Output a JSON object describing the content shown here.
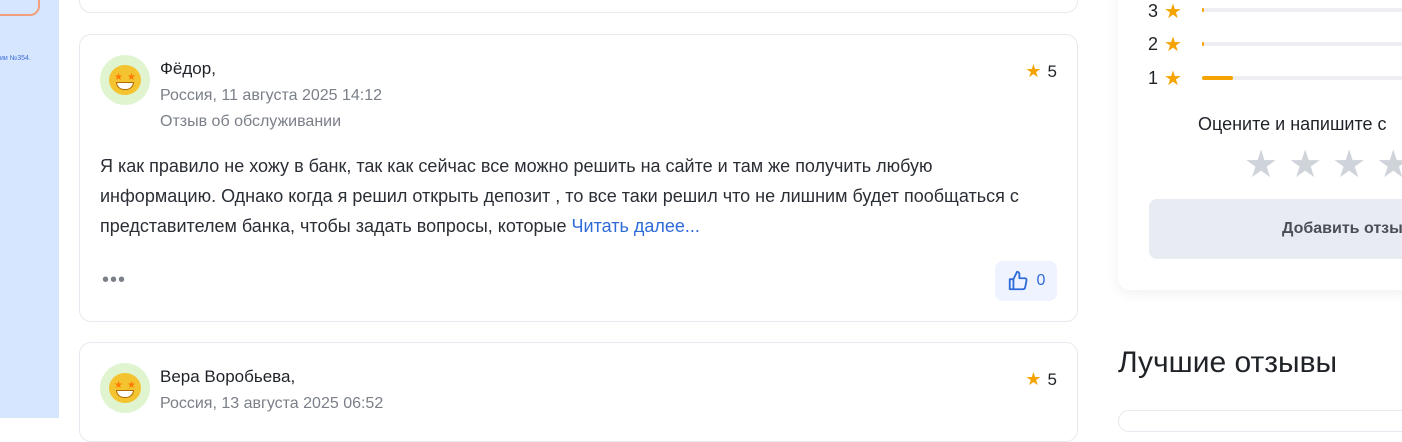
{
  "left_strip": {
    "tiny_text": "ии №354."
  },
  "reviews": [
    {
      "name": "Фёдор,",
      "meta": "Россия, 11 августа 2025 14:12",
      "type": "Отзыв об обслуживании",
      "rating": "5",
      "text": "Я как правило не хожу в банк, так как сейчас все можно решить на сайте и там же получить любую информацию. Однако когда я решил открыть депозит , то все таки решил что не лишним будет пообщаться с представителем банка, чтобы задать вопросы, которые",
      "read_more": "Читать далее...",
      "more": "•••",
      "likes": "0"
    },
    {
      "name": "Вера Воробьева,",
      "meta": "Россия, 13 августа 2025 06:52",
      "rating": "5"
    }
  ],
  "rating_widget": {
    "rows": [
      {
        "label": "3",
        "fraction": 0.01
      },
      {
        "label": "2",
        "fraction": 0.01
      },
      {
        "label": "1",
        "fraction": 0.14
      }
    ],
    "prompt": "Оцените и напишите с",
    "add_button": "Добавить отзы"
  },
  "best_reviews_title": "Лучшие отзывы",
  "colors": {
    "accent": "#2f6bd8",
    "star": "#f5a300",
    "left_strip": "#d6e6ff"
  },
  "icons": {
    "star": "star-icon",
    "like": "thumb-up-icon",
    "more": "more-dots-icon"
  }
}
